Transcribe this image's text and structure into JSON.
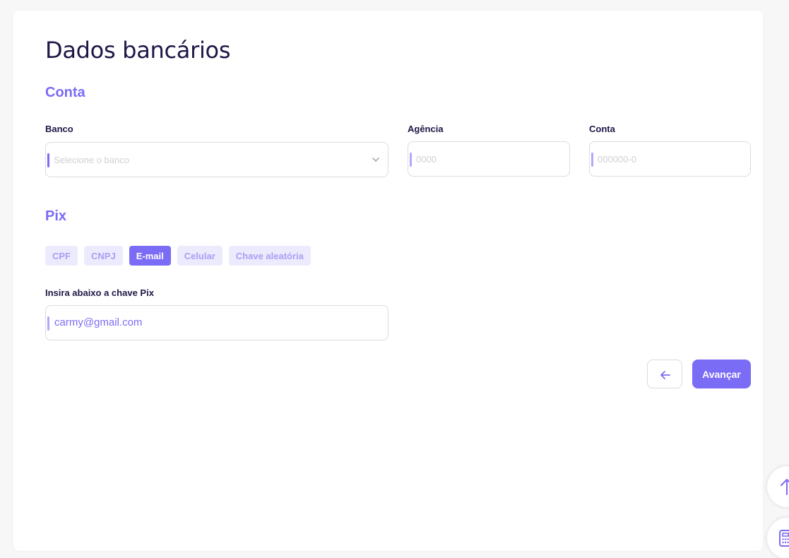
{
  "page": {
    "title": "Dados bancários"
  },
  "account": {
    "section_title": "Conta",
    "bank": {
      "label": "Banco",
      "placeholder": "Selecione o banco"
    },
    "agency": {
      "label": "Agência",
      "placeholder": "0000"
    },
    "account_number": {
      "label": "Conta",
      "placeholder": "000000-0"
    }
  },
  "pix": {
    "section_title": "Pix",
    "key_types": [
      "CPF",
      "CNPJ",
      "E-mail",
      "Celular",
      "Chave aleatória"
    ],
    "selected_key_type": "E-mail",
    "key_label": "Insira abaixo a chave Pix",
    "key_value": "carmy@gmail.com"
  },
  "actions": {
    "back_icon": "arrow-left-icon",
    "next_label": "Avançar"
  },
  "floating": {
    "scroll_top_icon": "arrow-up-icon",
    "calculator_icon": "calculator-icon"
  },
  "colors": {
    "accent": "#7b6cf6",
    "accent_light": "#ecebfd",
    "title": "#1d1746",
    "border": "#dcdce2"
  }
}
